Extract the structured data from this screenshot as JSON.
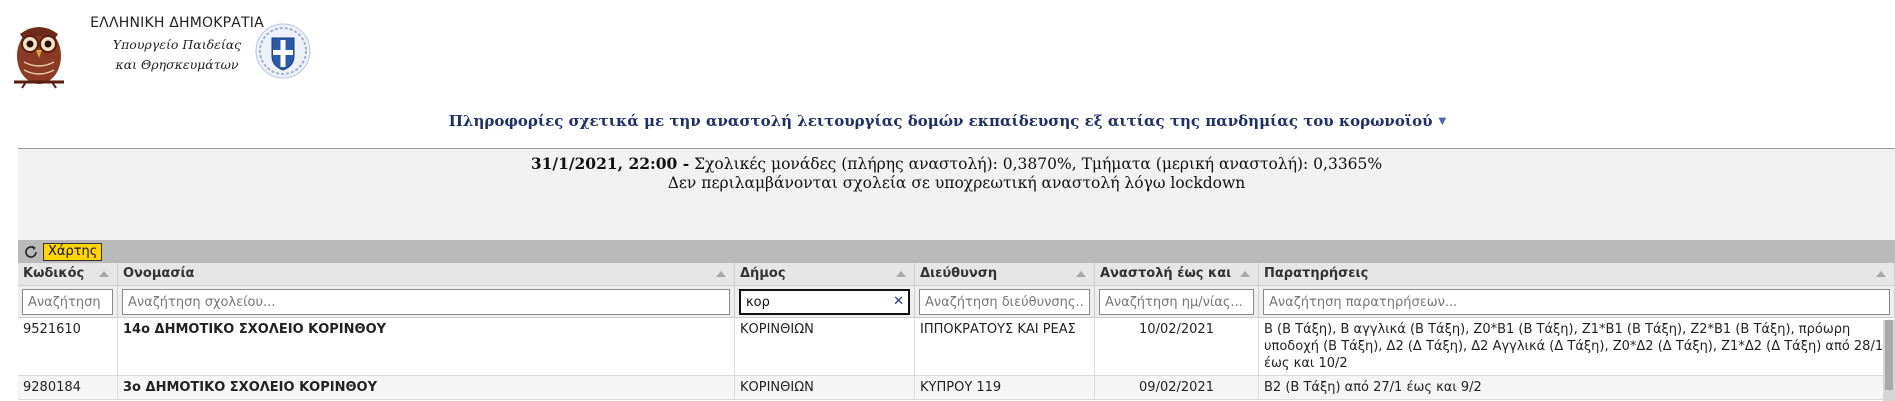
{
  "header": {
    "gov_title": "ΕΛΛΗΝΙΚΗ ΔΗΜΟΚΡΑΤΙΑ",
    "ministry_line1": "Υπουργείο Παιδείας",
    "ministry_line2": "και Θρησκευμάτων",
    "owl_logo": "owl-logo",
    "emblem": "greek-coat-of-arms"
  },
  "page_title": "Πληροφορίες σχετικά με την αναστολή λειτουργίας δομών εκπαίδευσης εξ αιτίας της πανδημίας του κορωνοϊού",
  "info": {
    "date": "31/1/2021, 22:00 -",
    "summary": " Σχολικές μονάδες (πλήρης αναστολή): 0,3870%, Τμήματα (μερική αναστολή): 0,3365%",
    "note": "Δεν περιλαμβάνονται σχολεία σε υποχρεωτική αναστολή λόγω lockdown"
  },
  "toolbar": {
    "refresh_icon": "refresh-icon",
    "map_button": "Χάρτης",
    "map_button_color": "#ffd400"
  },
  "columns": [
    "Κωδικός",
    "Ονομασία",
    "Δήμος",
    "Διεύθυνση",
    "Αναστολή έως και",
    "Παρατηρήσεις"
  ],
  "filters": [
    {
      "value": "",
      "placeholder": "Αναζήτηση"
    },
    {
      "value": "",
      "placeholder": "Αναζήτηση σχολείου..."
    },
    {
      "value": "κορ",
      "placeholder": ""
    },
    {
      "value": "",
      "placeholder": "Αναζήτηση διεύθυνσης..."
    },
    {
      "value": "",
      "placeholder": "Αναζήτηση ημ/νίας..."
    },
    {
      "value": "",
      "placeholder": "Αναζήτηση παρατηρήσεων..."
    }
  ],
  "rows": [
    {
      "code": "9521610",
      "name": "14ο ΔΗΜΟΤΙΚΟ ΣΧΟΛΕΙΟ ΚΟΡΙΝΘΟΥ",
      "municipality": "ΚΟΡΙΝΘΙΩΝ",
      "address": "ΙΠΠΟΚΡΑΤΟΥΣ ΚΑΙ ΡΕΑΣ",
      "until": "10/02/2021",
      "notes": "Β (Β Τάξη), Β  αγγλικά (Β Τάξη), Ζ0*Β1 (Β Τάξη), Ζ1*Β1 (Β Τάξη), Ζ2*Β1 (Β Τάξη), πρόωρη υποδοχή (Β Τάξη), Δ2 (Δ Τάξη), Δ2 Αγγλικά (Δ Τάξη), Ζ0*Δ2 (Δ Τάξη), Ζ1*Δ2 (Δ Τάξη) από 28/1 έως και 10/2"
    },
    {
      "code": "9280184",
      "name": "3ο ΔΗΜΟΤΙΚΟ ΣΧΟΛΕΙΟ ΚΟΡΙΝΘΟΥ",
      "municipality": "ΚΟΡΙΝΘΙΩΝ",
      "address": "ΚΥΠΡΟΥ 119",
      "until": "09/02/2021",
      "notes": "Β2 (Β Τάξη) από 27/1 έως και 9/2"
    }
  ]
}
